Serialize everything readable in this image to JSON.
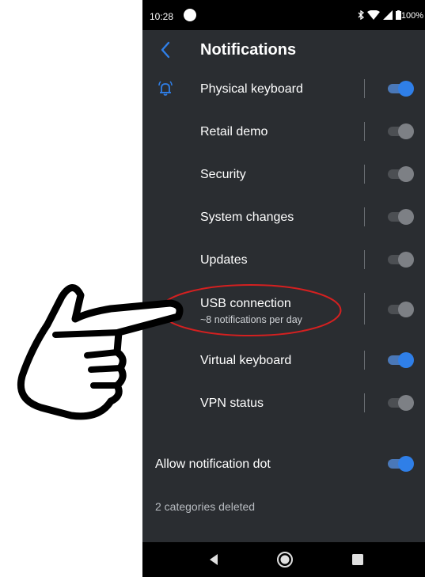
{
  "status_bar": {
    "time": "10:28",
    "battery": "100%",
    "icons": [
      "bluetooth-icon",
      "wifi-icon",
      "signal-icon",
      "battery-icon"
    ]
  },
  "app_bar": {
    "back_icon": "chevron-left-icon",
    "title": "Notifications"
  },
  "categories": [
    {
      "label": "Physical keyboard",
      "enabled": true,
      "icon": "alarm-bell-icon"
    },
    {
      "label": "Retail demo",
      "enabled": false
    },
    {
      "label": "Security",
      "enabled": false
    },
    {
      "label": "System changes",
      "enabled": false
    },
    {
      "label": "Updates",
      "enabled": false
    },
    {
      "label": "USB connection",
      "sub": "~8 notifications per day",
      "enabled": false
    },
    {
      "label": "Virtual keyboard",
      "enabled": true
    },
    {
      "label": "VPN status",
      "enabled": false
    }
  ],
  "allow_dot": {
    "label": "Allow notification dot",
    "enabled": true
  },
  "footer": {
    "deleted": "2 categories deleted"
  },
  "nav_bar": [
    "back-triangle-icon",
    "home-circle-icon",
    "recents-square-icon"
  ],
  "annotation": {
    "highlight": "red-ellipse",
    "pointer": "pointing-hand"
  },
  "colors": {
    "accent": "#2f7fe8",
    "background": "#2a2d31",
    "annotation": "#d42020"
  }
}
